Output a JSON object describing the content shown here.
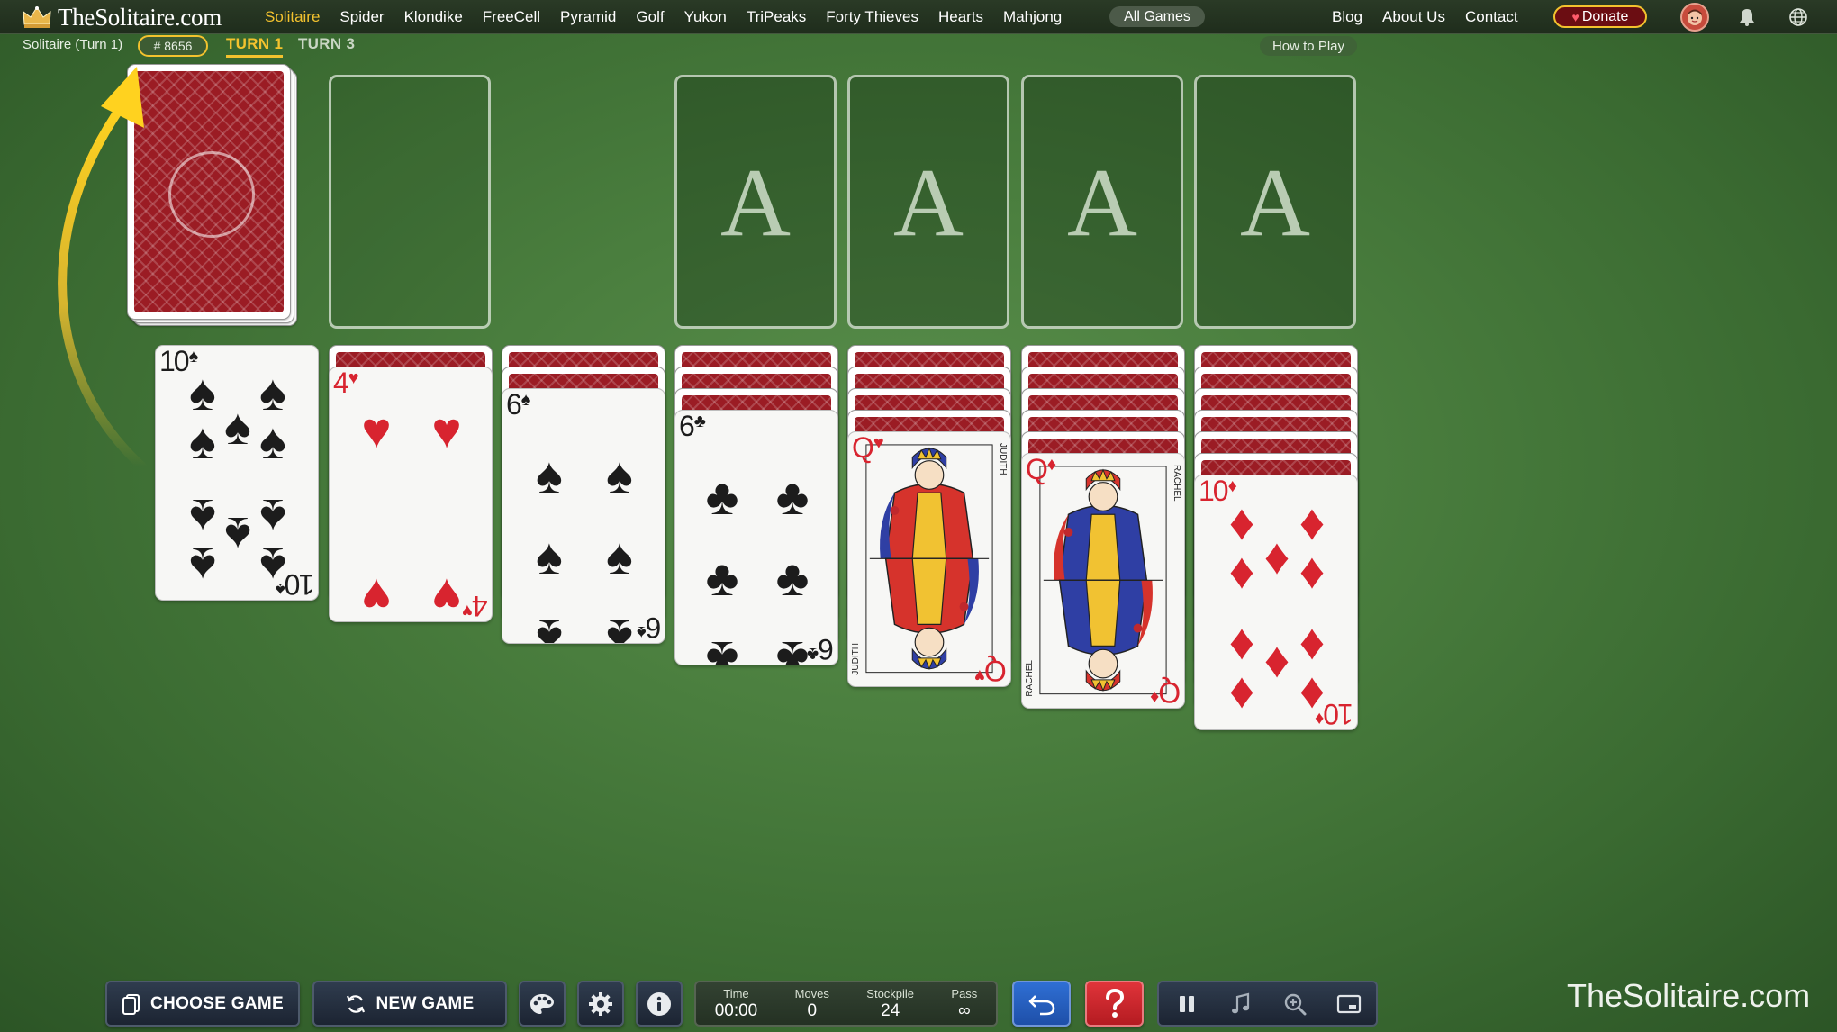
{
  "nav": {
    "logo": "TheSolitaire.com",
    "items": [
      "Solitaire",
      "Spider",
      "Klondike",
      "FreeCell",
      "Pyramid",
      "Golf",
      "Yukon",
      "TriPeaks",
      "Forty Thieves",
      "Hearts",
      "Mahjong"
    ],
    "active": "Solitaire",
    "all_games": "All Games",
    "right_items": [
      "Blog",
      "About Us",
      "Contact"
    ],
    "donate": "Donate"
  },
  "subbar": {
    "game_label": "Solitaire (Turn 1)",
    "game_number": "# 8656",
    "turn1": "TURN 1",
    "turn3": "TURN 3",
    "how_to_play": "How to Play"
  },
  "foundations": [
    "A",
    "A",
    "A",
    "A"
  ],
  "tableau": [
    {
      "hidden": 0,
      "rank": "10",
      "suit": "♠",
      "color": "black"
    },
    {
      "hidden": 1,
      "rank": "4",
      "suit": "♥",
      "color": "red"
    },
    {
      "hidden": 2,
      "rank": "6",
      "suit": "♠",
      "color": "black"
    },
    {
      "hidden": 3,
      "rank": "6",
      "suit": "♣",
      "color": "black"
    },
    {
      "hidden": 4,
      "rank": "Q",
      "suit": "♥",
      "color": "red",
      "face_name": "JUDITH"
    },
    {
      "hidden": 5,
      "rank": "Q",
      "suit": "♦",
      "color": "red",
      "face_name": "RACHEL"
    },
    {
      "hidden": 6,
      "rank": "10",
      "suit": "♦",
      "color": "red"
    }
  ],
  "bottom": {
    "choose_game": "CHOOSE GAME",
    "new_game": "NEW GAME",
    "stats": [
      {
        "label": "Time",
        "value": "00:00"
      },
      {
        "label": "Moves",
        "value": "0"
      },
      {
        "label": "Stockpile",
        "value": "24"
      },
      {
        "label": "Pass",
        "value": "∞"
      }
    ]
  },
  "watermark": "TheSolitaire.com",
  "colors": {
    "accent": "#f3c22e",
    "felt": "#4a7e3e",
    "card_back": "#9b1c24"
  }
}
